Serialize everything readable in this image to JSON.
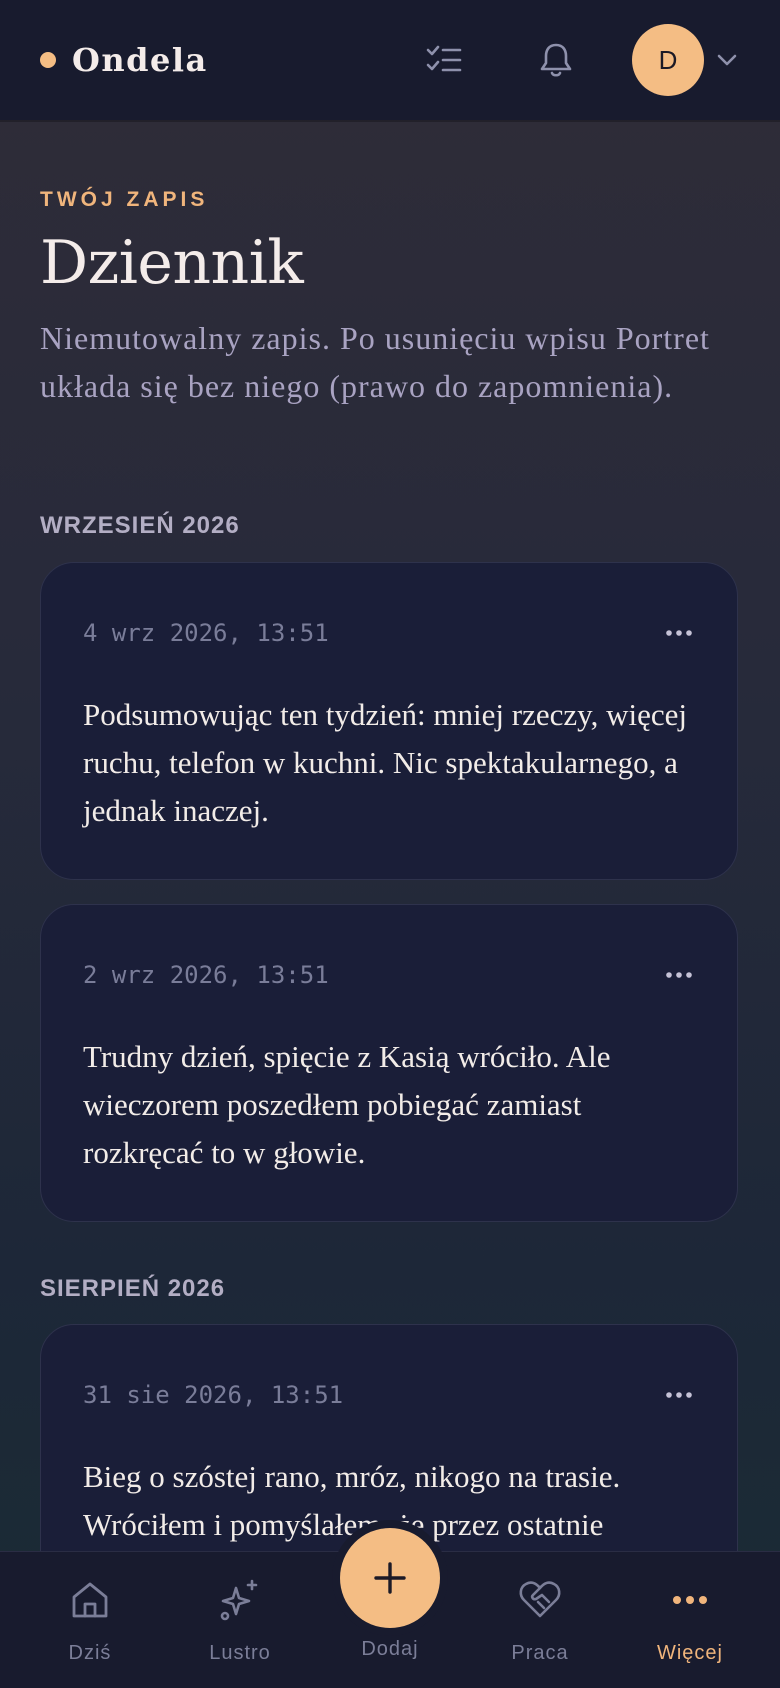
{
  "header": {
    "brand_name": "Ondela",
    "avatar_initial": "D"
  },
  "page": {
    "eyebrow": "TWÓJ ZAPIS",
    "title": "Dziennik",
    "description": "Niemutowalny zapis. Po usunięciu wpisu Portret układa się bez niego (prawo do zapomnienia)."
  },
  "sections": [
    {
      "label": "WRZESIEŃ 2026",
      "entries": [
        {
          "time": "4 wrz 2026, 13:51",
          "text": "Podsumowując ten tydzień: mniej rzeczy, więcej ruchu, telefon w kuchni. Nic spektakularnego, a jednak inaczej."
        },
        {
          "time": "2 wrz 2026, 13:51",
          "text": "Trudny dzień, spięcie z Kasią wróciło. Ale wieczorem poszedłem pobiegać zamiast rozkręcać to w głowie."
        }
      ]
    },
    {
      "label": "SIERPIEŃ 2026",
      "entries": [
        {
          "time": "31 sie 2026, 13:51",
          "text": "Bieg o szóstej rano, mróz, nikogo na trasie. Wróciłem i pomyślałem, że przez ostatnie"
        }
      ]
    }
  ],
  "nav": {
    "items": [
      {
        "label": "Dziś",
        "icon": "home-icon"
      },
      {
        "label": "Lustro",
        "icon": "sparkles-icon"
      },
      {
        "label": "Dodaj",
        "icon": "plus-icon"
      },
      {
        "label": "Praca",
        "icon": "heart-handshake-icon"
      },
      {
        "label": "Więcej",
        "icon": "more-dots-icon",
        "active": true
      }
    ]
  },
  "colors": {
    "accent": "#f4bd84",
    "background_top": "#2f2c38",
    "card": "#1a1e38",
    "bar": "#181b2e"
  }
}
